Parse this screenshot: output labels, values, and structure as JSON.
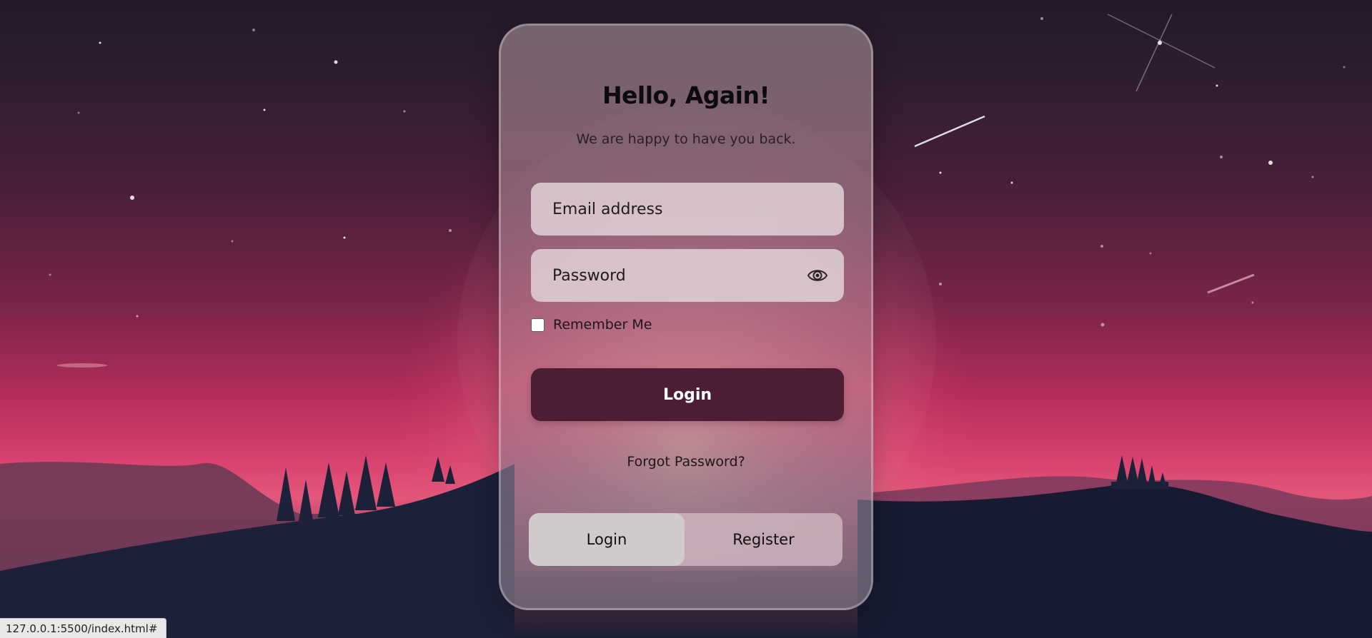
{
  "card": {
    "title": "Hello, Again!",
    "subtitle": "We are happy to have you back.",
    "email": {
      "placeholder": "Email address",
      "value": ""
    },
    "password": {
      "placeholder": "Password",
      "value": ""
    },
    "remember_label": "Remember Me",
    "remember_checked": false,
    "login_button": "Login",
    "forgot_link": "Forgot Password?",
    "toggle": {
      "login": "Login",
      "register": "Register",
      "active": "Login"
    }
  },
  "status_bar": {
    "url": "127.0.0.1:5500/index.html#"
  },
  "colors": {
    "primary_button": "#4c1d34",
    "toggle_active": "#cfcbcd",
    "field_bg": "#deccd2"
  },
  "icons": {
    "password_toggle": "eye-icon"
  }
}
